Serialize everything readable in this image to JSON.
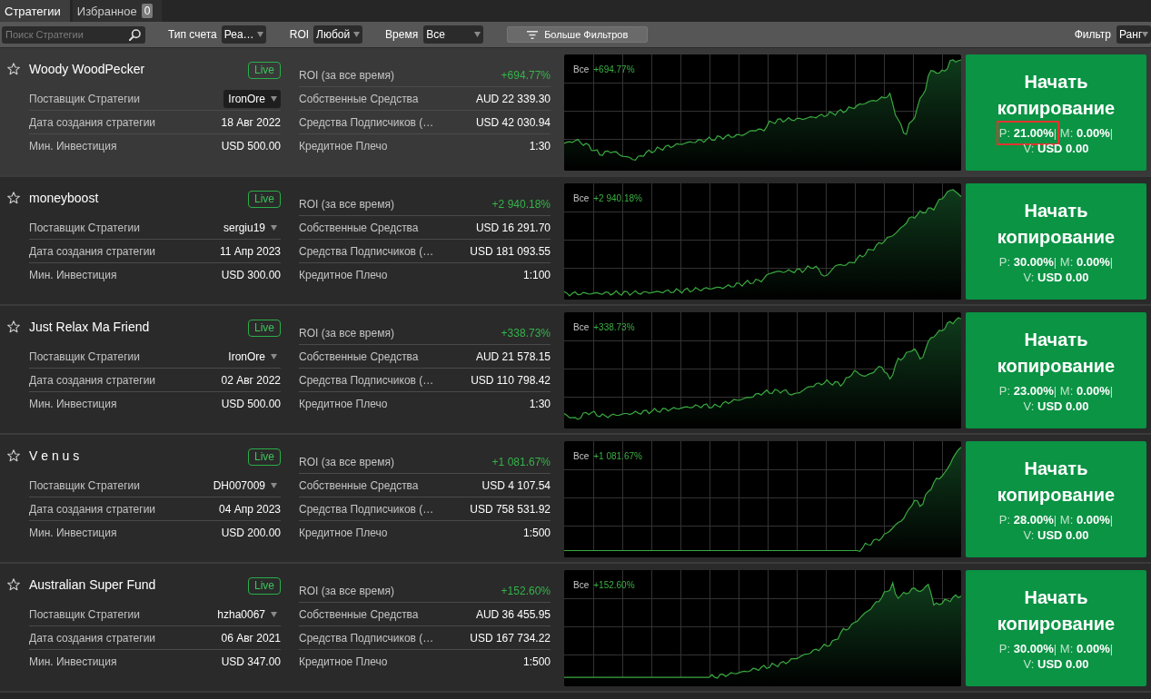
{
  "tabs": [
    {
      "label": "Стратегии",
      "selected": true
    },
    {
      "label": "Избранное",
      "selected": false,
      "badge": "0"
    }
  ],
  "filter_bar": {
    "search": {
      "placeholder": "Поиск Стратегии"
    },
    "selects": [
      {
        "label": "Тип счета",
        "value": "Реа…"
      },
      {
        "label": "ROI",
        "value": "Любой"
      },
      {
        "label": "Время",
        "value": "Все"
      }
    ],
    "more_filters_button": "Больше Фильтров",
    "sort": {
      "label": "Фильтр",
      "value": "Ранг"
    }
  },
  "strategies": [
    {
      "name": "Woody WoodPecker",
      "favorite": false,
      "hovered": true,
      "status": "Live",
      "details": [
        {
          "kind": "provider",
          "label": "Поставщик Стратегии",
          "value": "IronOre"
        },
        {
          "kind": "text",
          "label": "Дата создания стратегии",
          "value": "18 Авг 2022"
        },
        {
          "kind": "text",
          "label": "Мин. Инвестиция",
          "value": "USD 500.00"
        }
      ],
      "metrics": [
        {
          "label": "ROI (за все время)",
          "value": "+694.77%",
          "positive": true
        },
        {
          "label": "Собственные Средства",
          "value": "AUD 22 339.30",
          "positive": false
        },
        {
          "label": "Средства Подписчиков (…",
          "value": "USD 42 030.94",
          "positive": false
        },
        {
          "label": "Кредитное Плечо",
          "value": "1:30",
          "positive": false
        }
      ],
      "chart": {
        "period": "Все",
        "roi": "+694.77%"
      },
      "copy_button": {
        "label": "Начать копирование",
        "stats": [
          {
            "key": "P:",
            "value": "21.00%",
            "separator": "|",
            "highlighted": true
          },
          {
            "key": "M:",
            "value": "0.00%",
            "separator": "|",
            "highlighted": false
          },
          {
            "key": "V:",
            "value": "USD 0.00",
            "highlighted": false
          }
        ]
      }
    },
    {
      "name": "moneyboost",
      "favorite": false,
      "hovered": false,
      "status": "Live",
      "details": [
        {
          "kind": "provider",
          "label": "Поставщик Стратегии",
          "value": "sergiu19"
        },
        {
          "kind": "text",
          "label": "Дата создания стратегии",
          "value": "11 Апр 2023"
        },
        {
          "kind": "text",
          "label": "Мин. Инвестиция",
          "value": "USD 300.00"
        }
      ],
      "metrics": [
        {
          "label": "ROI (за все время)",
          "value": "+2 940.18%",
          "positive": true
        },
        {
          "label": "Собственные Средства",
          "value": "USD 16 291.70",
          "positive": false
        },
        {
          "label": "Средства Подписчиков (…",
          "value": "USD 181 093.55",
          "positive": false
        },
        {
          "label": "Кредитное Плечо",
          "value": "1:100",
          "positive": false
        }
      ],
      "chart": {
        "period": "Все",
        "roi": "+2 940.18%"
      },
      "copy_button": {
        "label": "Начать копирование",
        "stats": [
          {
            "key": "P:",
            "value": "30.00%",
            "separator": "|",
            "highlighted": false
          },
          {
            "key": "M:",
            "value": "0.00%",
            "separator": "|",
            "highlighted": false
          },
          {
            "key": "V:",
            "value": "USD 0.00",
            "highlighted": false
          }
        ]
      }
    },
    {
      "name": "Just Relax Ma Friend",
      "favorite": false,
      "hovered": false,
      "status": "Live",
      "details": [
        {
          "kind": "provider",
          "label": "Поставщик Стратегии",
          "value": "IronOre"
        },
        {
          "kind": "text",
          "label": "Дата создания стратегии",
          "value": "02 Авг 2022"
        },
        {
          "kind": "text",
          "label": "Мин. Инвестиция",
          "value": "USD 500.00"
        }
      ],
      "metrics": [
        {
          "label": "ROI (за все время)",
          "value": "+338.73%",
          "positive": true
        },
        {
          "label": "Собственные Средства",
          "value": "AUD 21 578.15",
          "positive": false
        },
        {
          "label": "Средства Подписчиков (…",
          "value": "USD 110 798.42",
          "positive": false
        },
        {
          "label": "Кредитное Плечо",
          "value": "1:30",
          "positive": false
        }
      ],
      "chart": {
        "period": "Все",
        "roi": "+338.73%"
      },
      "copy_button": {
        "label": "Начать копирование",
        "stats": [
          {
            "key": "P:",
            "value": "23.00%",
            "separator": "|",
            "highlighted": false
          },
          {
            "key": "M:",
            "value": "0.00%",
            "separator": "|",
            "highlighted": false
          },
          {
            "key": "V:",
            "value": "USD 0.00",
            "highlighted": false
          }
        ]
      }
    },
    {
      "name": "V e n u s",
      "favorite": false,
      "hovered": false,
      "status": "Live",
      "details": [
        {
          "kind": "provider",
          "label": "Поставщик Стратегии",
          "value": "DH007009"
        },
        {
          "kind": "text",
          "label": "Дата создания стратегии",
          "value": "04 Апр 2023"
        },
        {
          "kind": "text",
          "label": "Мин. Инвестиция",
          "value": "USD 200.00"
        }
      ],
      "metrics": [
        {
          "label": "ROI (за все время)",
          "value": "+1 081.67%",
          "positive": true
        },
        {
          "label": "Собственные Средства",
          "value": "USD 4 107.54",
          "positive": false
        },
        {
          "label": "Средства Подписчиков (…",
          "value": "USD 758 531.92",
          "positive": false
        },
        {
          "label": "Кредитное Плечо",
          "value": "1:500",
          "positive": false
        }
      ],
      "chart": {
        "period": "Все",
        "roi": "+1 081.67%"
      },
      "copy_button": {
        "label": "Начать копирование",
        "stats": [
          {
            "key": "P:",
            "value": "28.00%",
            "separator": "|",
            "highlighted": false
          },
          {
            "key": "M:",
            "value": "0.00%",
            "separator": "|",
            "highlighted": false
          },
          {
            "key": "V:",
            "value": "USD 0.00",
            "highlighted": false
          }
        ]
      }
    },
    {
      "name": "Australian Super Fund",
      "favorite": false,
      "hovered": false,
      "status": "Live",
      "details": [
        {
          "kind": "provider",
          "label": "Поставщик Стратегии",
          "value": "hzha0067"
        },
        {
          "kind": "text",
          "label": "Дата создания стратегии",
          "value": "06 Авг 2021"
        },
        {
          "kind": "text",
          "label": "Мин. Инвестиция",
          "value": "USD 347.00"
        }
      ],
      "metrics": [
        {
          "label": "ROI (за все время)",
          "value": "+152.60%",
          "positive": true
        },
        {
          "label": "Собственные Средства",
          "value": "AUD 36 455.95",
          "positive": false
        },
        {
          "label": "Средства Подписчиков (…",
          "value": "USD 167 734.22",
          "positive": false
        },
        {
          "label": "Кредитное Плечо",
          "value": "1:500",
          "positive": false
        }
      ],
      "chart": {
        "period": "Все",
        "roi": "+152.60%"
      },
      "copy_button": {
        "label": "Начать копирование",
        "stats": [
          {
            "key": "P:",
            "value": "30.00%",
            "separator": "|",
            "highlighted": false
          },
          {
            "key": "M:",
            "value": "0.00%",
            "separator": "|",
            "highlighted": false
          },
          {
            "key": "V:",
            "value": "USD 0.00",
            "highlighted": false
          }
        ]
      }
    }
  ]
}
